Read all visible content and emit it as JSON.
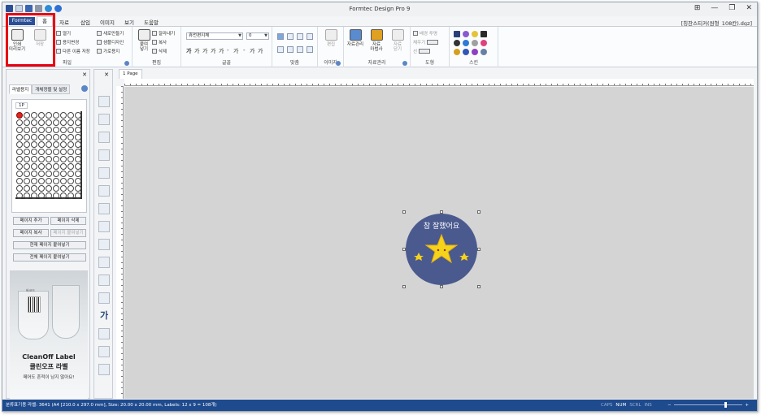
{
  "title": "Formtec Design Pro 9",
  "window_buttons": [
    "⊞",
    "—",
    "❐",
    "✕"
  ],
  "filename": "[칭찬스티커(원형_108칸).dgz]",
  "menu": {
    "formtec": "Formtec",
    "home": "홈",
    "items": [
      "자료",
      "삽입",
      "이미지",
      "보기",
      "도움말"
    ]
  },
  "ribbon": {
    "file": {
      "label": "파일",
      "print": "인쇄\n미리보기",
      "save": "저장",
      "small": [
        "열기",
        "용지변경",
        "다른 이름 저장"
      ],
      "small2": [
        "새로만들기",
        "샘플디자인",
        "가로용지"
      ]
    },
    "edit": {
      "label": "편집",
      "paste": "붙여\n넣기",
      "small": [
        "잘라내기",
        "복사",
        "삭제"
      ]
    },
    "font": {
      "label": "글꼴",
      "name": "휴먼편지체",
      "size": "0",
      "styles": [
        "가",
        "가",
        "가",
        "가",
        "가",
        "-",
        "가",
        "-",
        "가",
        "가"
      ]
    },
    "align": {
      "label": "맞춤"
    },
    "image": {
      "label": "이미지",
      "edit": "편집"
    },
    "data": {
      "label": "자료관리",
      "items": [
        "자료관리",
        "자료\n마법사",
        "자료\n닫기"
      ]
    },
    "shape": {
      "label": "도형",
      "items": [
        "배경 투명",
        "채우기",
        "선"
      ]
    },
    "skin": {
      "label": "스킨"
    }
  },
  "left_panel": {
    "tabs": [
      "라벨용지",
      "개체정렬 및 설정"
    ],
    "page_tab": "1P",
    "buttons": [
      "페이지 추가",
      "페이지 삭제",
      "페이지 복사",
      "페이지 붙여넣기",
      "현재 페이지 붙여넣기",
      "전체 페이지 붙여넣기"
    ],
    "ad": {
      "brand": "CleanOff Label",
      "brand_ko": "클린오프 라벨",
      "tagline": "떼어도 흔적이 남지 않아요!",
      "tag": "바코드"
    }
  },
  "tool_text": "가",
  "doc": {
    "tab": "1 Page",
    "label_text": "참 잘했어요"
  },
  "status": {
    "text": "분류표기용 라벨: 3641 (A4 [210.0 x 297.0 mm], Size: 20.00 x 20.00 mm, Labels: 12 x 9 = 108개)",
    "keys": [
      "CAPS",
      "NUM",
      "SCRL",
      "INS"
    ],
    "keys_on": [
      false,
      true,
      false,
      false
    ],
    "zoom_minus": "−",
    "zoom_plus": "+"
  },
  "colors": {
    "brand_blue": "#2b4f96",
    "status_blue": "#1e4a8e",
    "highlight_red": "#e60012",
    "label_circle": "#4a5a8f",
    "star_yellow": "#f6d21b"
  }
}
